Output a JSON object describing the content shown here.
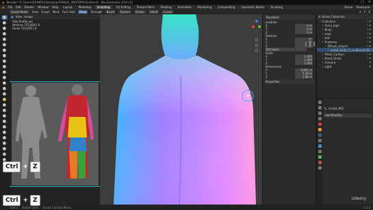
{
  "window": {
    "title": "Blender* [C:\\Users\\EXAMPLE\\Desktop\\FEMALE_ANATOMY\\03.blend] - Mac/Gamedev [Ctrl+S]",
    "controls": [
      "–",
      "□",
      "✕"
    ]
  },
  "menu": {
    "items": [
      "File",
      "Edit",
      "Render",
      "Window",
      "Help"
    ],
    "workspaces": [
      "Layout",
      "Modeling",
      "Sculpting",
      "UV Editing",
      "Texture Paint",
      "Shading",
      "Animation",
      "Rendering",
      "Compositing",
      "Geometry Nodes",
      "Scripting"
    ],
    "active_workspace": "Sculpting",
    "scene": "Scene",
    "view_layer": "ViewLayer"
  },
  "tool_header": {
    "mode": "Sculpt Mode",
    "items": [
      "View",
      "Sculpt",
      "Mask",
      "Face Sets"
    ],
    "brush": "Draw",
    "strength_label": "Strength",
    "options": [
      "Brush",
      "Texture",
      "Stroke",
      "Falloff",
      "Cursor"
    ],
    "right": [
      "X",
      "Y",
      "Z"
    ]
  },
  "image_panel": {
    "header": [
      "View",
      "Image"
    ],
    "file": "Side Profile.exr",
    "line1": "Vertices 715,819 | 0",
    "line2": "Faces 715,816 | 0"
  },
  "npanel": {
    "section": "Transform",
    "groups": [
      {
        "label": "Location",
        "rows": [
          [
            "X",
            "0 m"
          ],
          [
            "Y",
            "0 m"
          ],
          [
            "Z",
            "0 m"
          ]
        ]
      },
      {
        "label": "Rotation",
        "rows": [
          [
            "X",
            "0°"
          ],
          [
            "Y",
            "0°"
          ],
          [
            "Z",
            "0°"
          ]
        ]
      },
      {
        "label": "XYZ Euler",
        "rows": []
      },
      {
        "label": "Scale",
        "rows": [
          [
            "X",
            "1.000"
          ],
          [
            "Y",
            "1.000"
          ],
          [
            "Z",
            "1.000"
          ]
        ]
      },
      {
        "label": "Dimensions",
        "rows": [
          [
            "X",
            "0.491 m"
          ],
          [
            "Y",
            "2.36 m"
          ],
          [
            "Z",
            "1.88 m"
          ]
        ]
      }
    ],
    "properties_section": "Properties",
    "tabs": [
      "Item",
      "Tool",
      "View"
    ]
  },
  "outliner": {
    "header": "Scene Collection",
    "rows": [
      "Collection",
      "Torso_high",
      "Body",
      "Legs",
      "Hair",
      "Anatomy",
      "ZBrush_Import",
      "sculpt_body_V_multires(0.41)",
      "Mesh_Cartoon",
      "Hand_Ghost",
      "Camera",
      "Light"
    ]
  },
  "properties": {
    "object": "Sculpt_002",
    "modifier": "Add Modifier",
    "active_tab_color": "#3c5f93"
  },
  "statusbar": {
    "items": [
      "Select",
      "Rotate View",
      "Sculpt Context Menu"
    ],
    "version": "3.2.0"
  },
  "overlay": {
    "key1": "Ctrl",
    "plus1": "+",
    "z1": "Z",
    "key2": "Ctrl",
    "plus2": "+",
    "z2": "Z",
    "watermark": "Udemy"
  },
  "colors": {
    "accent": "#3c5f93",
    "cyan": "#2ab7c9"
  }
}
